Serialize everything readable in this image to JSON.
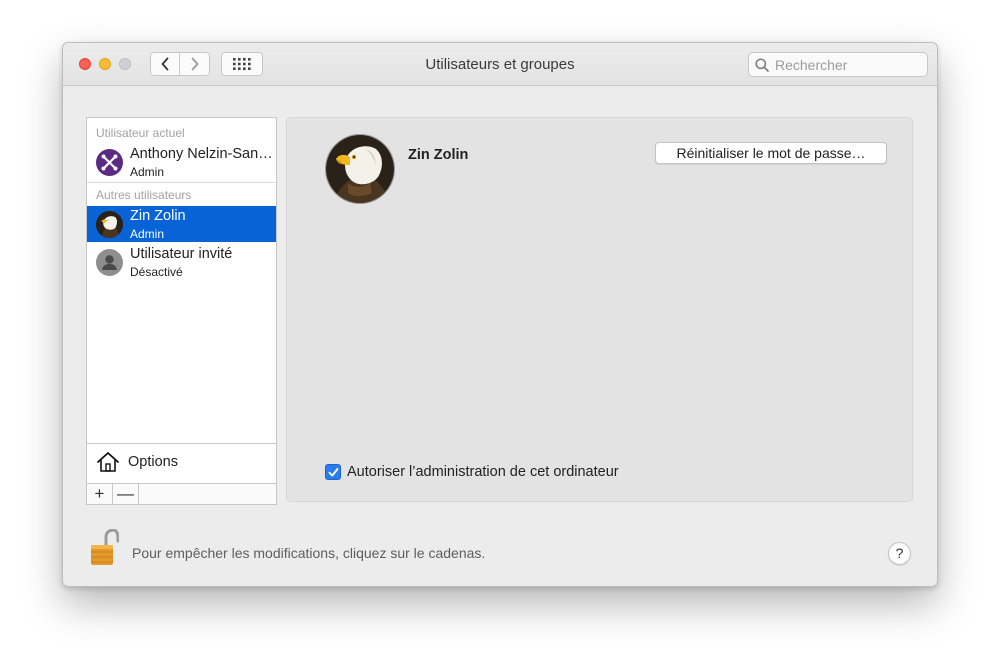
{
  "window": {
    "title": "Utilisateurs et groupes"
  },
  "search": {
    "placeholder": "Rechercher"
  },
  "sidebar": {
    "current_user_section": "Utilisateur actuel",
    "current_user": {
      "name": "Anthony Nelzin-San…",
      "role": "Admin",
      "avatar_icon": "crossed-tools-avatar-icon",
      "avatar_color": "#5b2a82"
    },
    "other_users_section": "Autres utilisateurs",
    "other_users": [
      {
        "name": "Zin Zolin",
        "role": "Admin",
        "selected": true,
        "avatar_icon": "eagle-avatar-icon"
      },
      {
        "name": "Utilisateur invité",
        "role": "Désactivé",
        "selected": false,
        "avatar_icon": "guest-person-icon"
      }
    ],
    "options_label": "Options",
    "add_label": "+",
    "remove_label": "—"
  },
  "detail": {
    "username": "Zin Zolin",
    "reset_password_label": "Réinitialiser le mot de passe…",
    "allow_admin_label": "Autoriser l’administration de cet ordinateur",
    "allow_admin_checked": true
  },
  "footer": {
    "lock_text": "Pour empêcher les modifications, cliquez sur le cadenas.",
    "help_label": "?"
  },
  "colors": {
    "selection": "#0864d6",
    "checkbox": "#2b7cf0",
    "close": "#fe5f57",
    "minimize": "#febc2e"
  }
}
